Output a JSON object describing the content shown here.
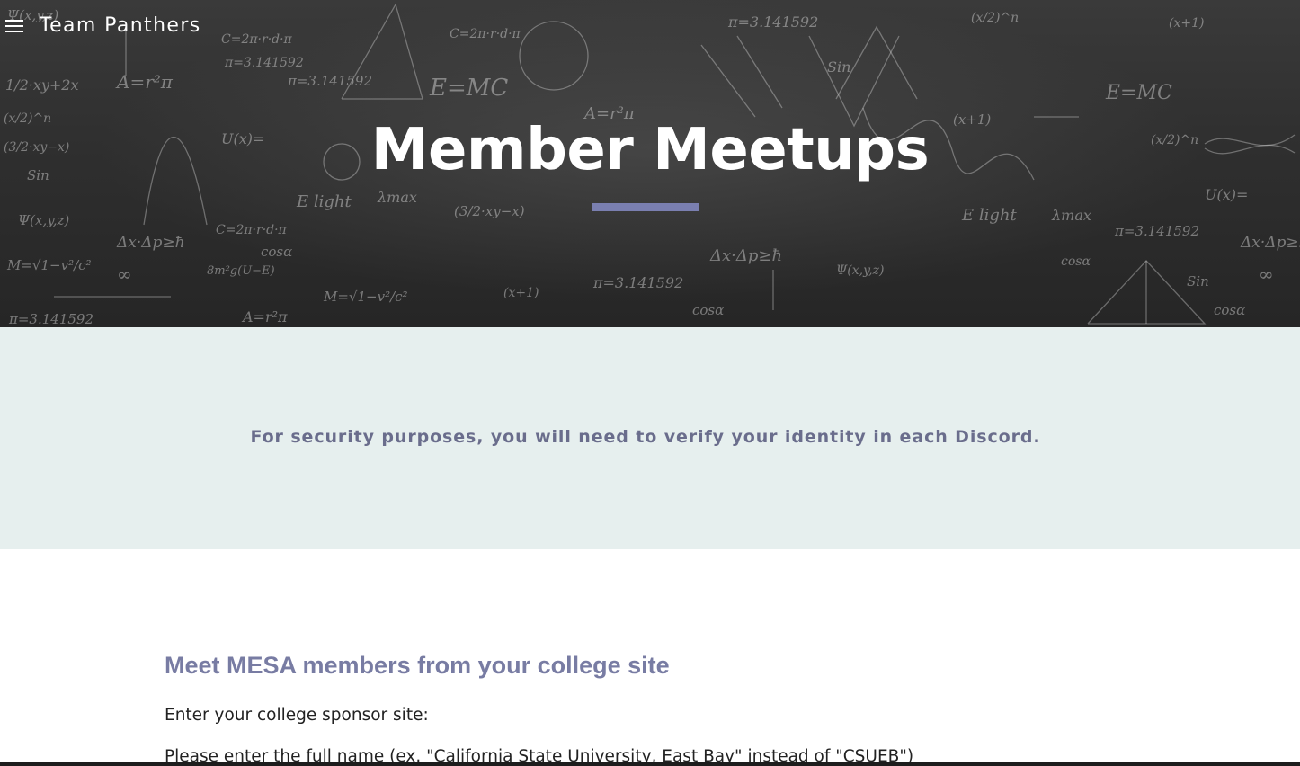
{
  "header": {
    "menu_icon": "hamburger-menu-icon",
    "site_title": "Team Panthers"
  },
  "hero": {
    "title": "Member Meetups",
    "underline_color": "#7a7fb0",
    "chalk": {
      "t1": "C=2π·r·d·π",
      "t2": "π=3.141592",
      "t3": "A=r²π",
      "t4": "E=MC",
      "t5": "Δx·Δp≥ħ",
      "t6": "(x/2)^n",
      "t7": "M=√1−v²/c²",
      "t8": "(3/2·xy−x)",
      "t9": "Ψ(x,y,z)",
      "t10": "Sin",
      "t11": "cosα",
      "t12": "E light",
      "t13": "λmax",
      "t14": "U(x)=",
      "t15": "8m²g(U−E)",
      "t16": "(x+1)",
      "t17": "∞",
      "t18": "1/2·xy+2x"
    }
  },
  "notice": {
    "text": "For security purposes, you will need to verify your identity in each Discord."
  },
  "content": {
    "heading": "Meet MESA members from your college site",
    "prompt": "Enter your college sponsor site:",
    "instruction": "Please enter the full name (ex. \"California State University, East Bay\" instead of \"CSUEB\")"
  },
  "colors": {
    "accent": "#7a7fb0",
    "notice_bg": "#e6efee",
    "notice_text": "#6a6d8c",
    "heading": "#787ca3"
  }
}
